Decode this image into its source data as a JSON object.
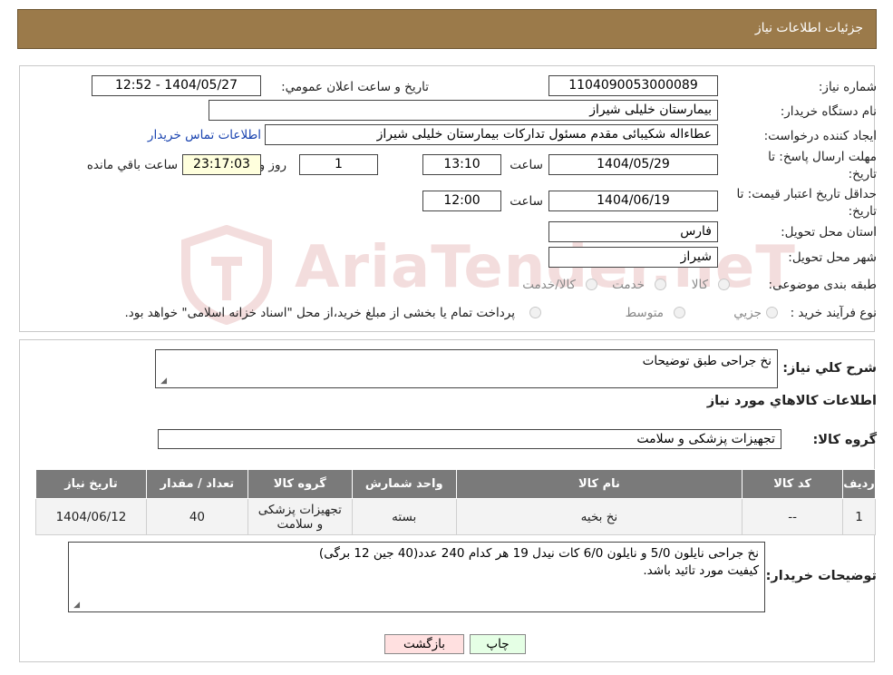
{
  "header": {
    "title": "جزئیات اطلاعات نیاز"
  },
  "form": {
    "need_number_label": "شماره نیاز:",
    "need_number": "1104090053000089",
    "announce_label": "تاریخ و ساعت اعلان عمومي:",
    "announce_value": "1404/05/27 - 12:52",
    "buyer_org_label": "نام دستگاه خريدار:",
    "buyer_org": "بیمارستان خلیلی شیراز",
    "creator_label": "ايجاد كننده درخواست:",
    "creator": "عطاءاله شکیبائی مقدم مسئول تدارکات  بیمارستان خلیلی شیراز",
    "contact_link": "اطلاعات تماس خريدار",
    "reply_deadline_label_1": "مهلت ارسال پاسخ: تا",
    "reply_deadline_label_2": "تاريخ:",
    "reply_date": "1404/05/29",
    "time_label": "ساعت",
    "reply_time": "13:10",
    "days_value": "1",
    "days_label": "روز و",
    "remaining_time": "23:17:03",
    "remaining_label": "ساعت باقي مانده",
    "validity_label_1": "حداقل تاريخ اعتبار قيمت: تا",
    "validity_label_2": "تاريخ:",
    "validity_date": "1404/06/19",
    "validity_time": "12:00",
    "province_label": "استان محل تحويل:",
    "province": "فارس",
    "city_label": "شهر محل تحويل:",
    "city": "شیراز",
    "category_label": "طبقه بندی موضوعی:",
    "category_options": [
      "کالا",
      "خدمت",
      "کالا/خدمت"
    ],
    "process_label": "نوع فرآيند خريد :",
    "process_options": [
      "جزيي",
      "متوسط"
    ],
    "process_note": "پرداخت تمام يا بخشی از مبلغ خريد،از محل \"اسناد خزانه اسلامی\" خواهد بود."
  },
  "details": {
    "summary_label": "شرح كلي نياز:",
    "summary_text": "نخ جراحی طبق توضیحات",
    "goods_info_title": "اطلاعات كالاهاي مورد نياز",
    "goods_group_label": "گروه كالا:",
    "goods_group": "تجهیزات پزشکی و سلامت",
    "table_headers": [
      "رديف",
      "كد كالا",
      "نام كالا",
      "واحد شمارش",
      "گروه كالا",
      "تعداد / مقدار",
      "تاريخ نياز"
    ],
    "table_rows": [
      [
        "1",
        "--",
        "نخ بخیه",
        "بسته",
        "تجهیزات پزشکی و سلامت",
        "40",
        "1404/06/12"
      ]
    ],
    "buyer_notes_label": "توضيحات خريدار:",
    "buyer_notes_line1": "نخ جراحی نایلون 5/0 و نایلون 6/0 کات نیدل 19 هر کدام 240 عدد(40 جین 12 برگی)",
    "buyer_notes_line2": "کیفیت مورد تائید باشد."
  },
  "buttons": {
    "print": "چاپ",
    "back": "بازگشت"
  },
  "watermark": "AriaTender.neT"
}
